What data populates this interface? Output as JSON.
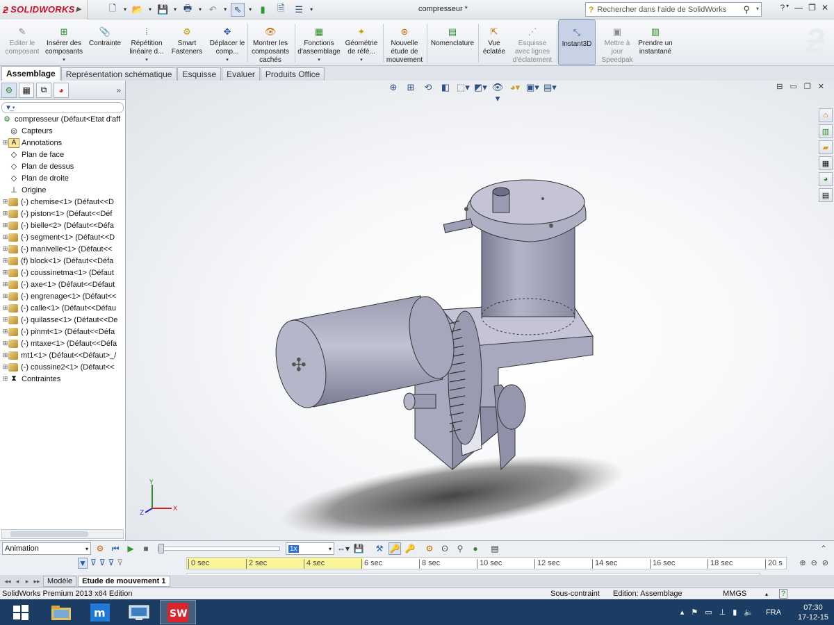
{
  "app": {
    "brand": "SOLIDWORKS",
    "document_title": "compresseur *",
    "help_search_placeholder": "Rechercher dans l'aide de SolidWorks"
  },
  "command_manager": [
    {
      "label": "Editer le composant",
      "icon": "edit-component-icon",
      "disabled": true
    },
    {
      "label": "Insérer des composants",
      "icon": "insert-components-icon",
      "dropdown": true
    },
    {
      "label": "Contrainte",
      "icon": "mate-paperclip-icon"
    },
    {
      "label": "Répétition linéaire d...",
      "icon": "linear-pattern-icon",
      "dropdown": true
    },
    {
      "label": "Smart Fasteners",
      "icon": "smart-fasteners-icon"
    },
    {
      "label": "Déplacer le comp...",
      "icon": "move-component-icon",
      "dropdown": true
    },
    {
      "label": "Montrer les composants cachés",
      "icon": "show-hidden-icon"
    },
    {
      "label": "Fonctions d'assemblage",
      "icon": "assembly-features-icon",
      "dropdown": true
    },
    {
      "label": "Géométrie de réfé...",
      "icon": "reference-geometry-icon",
      "dropdown": true
    },
    {
      "label": "Nouvelle étude de mouvement",
      "icon": "new-motion-study-icon"
    },
    {
      "label": "Nomenclature",
      "icon": "bom-icon"
    },
    {
      "label": "Vue éclatée",
      "icon": "exploded-view-icon"
    },
    {
      "label": "Esquisse avec lignes d'éclatement",
      "icon": "explode-line-sketch-icon",
      "disabled": true
    },
    {
      "label": "Instant3D",
      "icon": "instant3d-icon",
      "active": true
    },
    {
      "label": "Mettre à jour Speedpak",
      "icon": "speedpak-icon",
      "disabled": true
    },
    {
      "label": "Prendre un instantané",
      "icon": "snapshot-icon"
    }
  ],
  "tabs": [
    "Assemblage",
    "Représentation schématique",
    "Esquisse",
    "Evaluer",
    "Produits Office"
  ],
  "tabs_active": "Assemblage",
  "feature_tree": {
    "root": "compresseur  (Défaut<Etat d'aff",
    "items": [
      {
        "label": "Capteurs",
        "icon": "sensors-icon",
        "expand": false
      },
      {
        "label": "Annotations",
        "icon": "annotations-icon",
        "expand": true
      },
      {
        "label": "Plan de face",
        "icon": "plane-icon",
        "expand": false
      },
      {
        "label": "Plan de dessus",
        "icon": "plane-icon",
        "expand": false
      },
      {
        "label": "Plan de droite",
        "icon": "plane-icon",
        "expand": false
      },
      {
        "label": "Origine",
        "icon": "origin-icon",
        "expand": false
      },
      {
        "label": "(-) chemise<1> (Défaut<<D",
        "icon": "part-icon",
        "expand": true
      },
      {
        "label": "(-) piston<1> (Défaut<<Déf",
        "icon": "part-icon",
        "expand": true
      },
      {
        "label": "(-) bielle<2> (Défaut<<Défa",
        "icon": "part-icon",
        "expand": true
      },
      {
        "label": "(-) segment<1> (Défaut<<D",
        "icon": "part-icon",
        "expand": true
      },
      {
        "label": "(-) manivelle<1> (Défaut<<",
        "icon": "part-icon",
        "expand": true
      },
      {
        "label": "(f) block<1> (Défaut<<Défa",
        "icon": "part-icon",
        "expand": true
      },
      {
        "label": "(-) coussinetma<1> (Défaut",
        "icon": "part-icon",
        "expand": true
      },
      {
        "label": "(-) axe<1> (Défaut<<Défaut",
        "icon": "part-icon",
        "expand": true
      },
      {
        "label": "(-) engrenage<1> (Défaut<<",
        "icon": "part-icon",
        "expand": true
      },
      {
        "label": "(-) calle<1> (Défaut<<Défau",
        "icon": "part-icon",
        "expand": true
      },
      {
        "label": "(-) quilasse<1> (Défaut<<De",
        "icon": "part-icon",
        "expand": true
      },
      {
        "label": "(-) pinmt<1> (Défaut<<Défa",
        "icon": "part-icon",
        "expand": true
      },
      {
        "label": "(-) mtaxe<1> (Défaut<<Défa",
        "icon": "part-icon",
        "expand": true
      },
      {
        "label": "mt1<1> (Défaut<<Défaut>_/",
        "icon": "part-icon",
        "expand": true
      },
      {
        "label": "(-) coussine2<1> (Défaut<<",
        "icon": "part-icon",
        "expand": true
      },
      {
        "label": "Contraintes",
        "icon": "mates-icon",
        "expand": true
      }
    ]
  },
  "triad": {
    "x": "X",
    "y": "Y",
    "z": "Z"
  },
  "motion": {
    "study_type": "Animation",
    "speed": "1x",
    "timeline_ticks": [
      "0 sec",
      "2 sec",
      "4 sec",
      "6 sec",
      "8 sec",
      "10 sec",
      "12 sec",
      "14 sec",
      "16 sec",
      "18 sec",
      "20 s"
    ],
    "doc_tabs": [
      "Modèle",
      "Etude de mouvement 1"
    ],
    "doc_tab_active": "Etude de mouvement 1"
  },
  "status": {
    "edition": "SolidWorks Premium 2013 x64 Edition",
    "constraint": "Sous-contraint",
    "editing": "Edition: Assemblage",
    "units": "MMGS",
    "help": "?"
  },
  "taskbar": {
    "language": "FRA",
    "time": "07:30",
    "date": "17-12-15"
  }
}
